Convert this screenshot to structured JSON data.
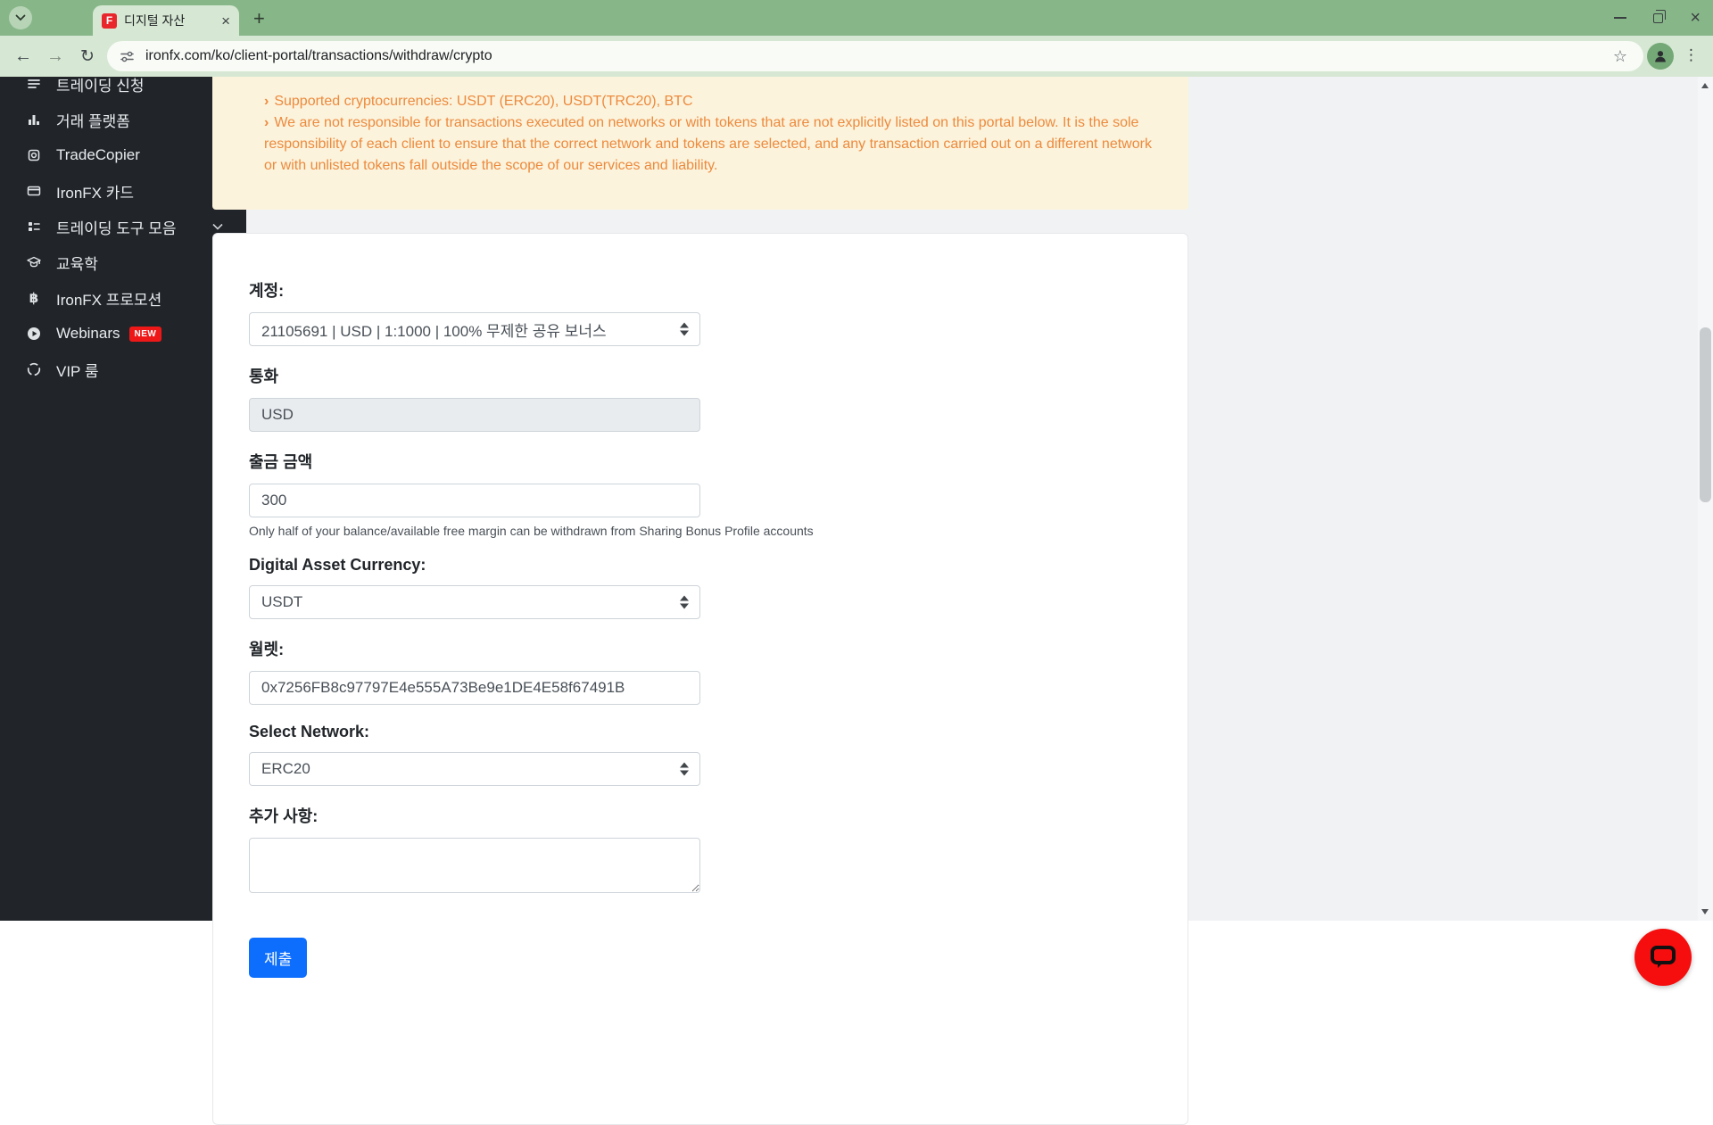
{
  "browser": {
    "tab_title": "디지털 자산",
    "favicon_letter": "F",
    "url": "ironfx.com/ko/client-portal/transactions/withdraw/crypto",
    "new_tab": "+",
    "close_tab": "×",
    "close_window": "×",
    "back": "←",
    "forward": "→",
    "reload": "↻",
    "bookmark_star": "☆",
    "menu_dots": "⋮"
  },
  "sidebar": {
    "items": [
      {
        "label": "트레이딩 신청",
        "icon": "list-icon",
        "chevron": true
      },
      {
        "label": "거래 플랫폼",
        "icon": "bar-chart-icon",
        "chevron": false
      },
      {
        "label": "TradeCopier",
        "icon": "copy-icon",
        "chevron": true
      },
      {
        "label": "IronFX 카드",
        "icon": "credit-card-icon",
        "chevron": true
      },
      {
        "label": "트레이딩 도구 모음",
        "icon": "tools-icon",
        "chevron": true
      },
      {
        "label": "교육학",
        "icon": "education-icon",
        "chevron": true
      },
      {
        "label": "IronFX 프로모션",
        "icon": "bitcoin-icon",
        "chevron": false,
        "icon_glyph": "฿"
      },
      {
        "label": "Webinars",
        "icon": "play-icon",
        "chevron": false,
        "badge": "NEW"
      },
      {
        "label": "VIP 룸",
        "icon": "vip-ring-icon",
        "chevron": false
      }
    ]
  },
  "notice": {
    "bullet_char": "›",
    "line1": "Supported cryptocurrencies: USDT (ERC20), USDT(TRC20), BTC",
    "line2": "We are not responsible for transactions executed on networks or with tokens that are not explicitly listed on this portal below. It is the sole responsibility of each client to ensure that the correct network and tokens are selected, and any transaction carried out on a different network or with unlisted tokens fall outside the scope of our services and liability."
  },
  "form": {
    "account_label": "계정:",
    "account_value": "21105691 | USD | 1:1000 | 100% 무제한 공유 보너스",
    "currency_label": "통화",
    "currency_value": "USD",
    "amount_label": "출금 금액",
    "amount_value": "300",
    "amount_help": "Only half of your balance/available free margin can be withdrawn from Sharing Bonus Profile accounts",
    "asset_label": "Digital Asset Currency:",
    "asset_value": "USDT",
    "wallet_label": "월렛:",
    "wallet_value": "0x7256FB8c97797E4e555A73Be9e1DE4E58f67491B",
    "network_label": "Select Network:",
    "network_value": "ERC20",
    "notes_label": "추가 사항:",
    "notes_value": "",
    "submit_label": "제출"
  },
  "colors": {
    "theme_green_dark": "#87b789",
    "theme_green_light": "#d6e8d3",
    "sidebar_bg": "#212529",
    "notice_bg": "#fcf3dc",
    "notice_text": "#ec8a3d",
    "accent_blue": "#0d6efd",
    "badge_red": "#ef1818",
    "favicon_red": "#e8262c",
    "chat_red": "#f60d0d",
    "input_disabled_bg": "#e9ecef"
  }
}
